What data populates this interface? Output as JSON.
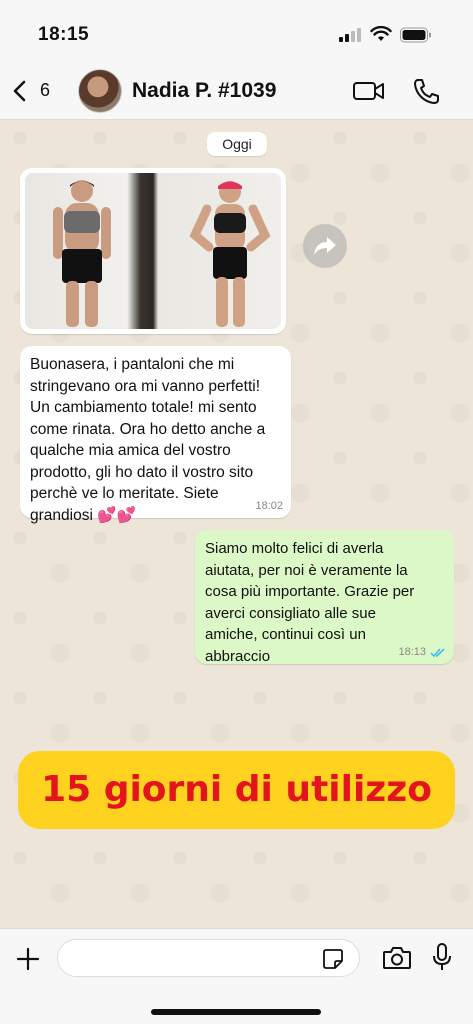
{
  "status_bar": {
    "time": "18:15",
    "icons": [
      "signal-icon",
      "wifi-icon",
      "battery-icon"
    ]
  },
  "header": {
    "unread_count": "6",
    "contact_name": "Nadia P. #1039",
    "icons": [
      "chevron-left-icon",
      "video-icon",
      "phone-icon"
    ]
  },
  "chat": {
    "date_label": "Oggi",
    "incoming_message": {
      "text": "Buonasera, i pantaloni che mi\nstringevano ora mi vanno perfetti!\nUn cambiamento totale! mi sento\ncome rinata. Ora ho detto anche a\nqualche mia amica del vostro\nprodotto, gli ho dato il vostro sito\nperchè ve lo meritate. Siete\ngrandiosi 💕💕",
      "time": "18:02"
    },
    "outgoing_message": {
      "text": "Siamo molto felici di averla\naiutata, per noi è veramente la\ncosa più importante. Grazie per\naverci consigliato alle sue\namiche, continui così un\nabbraccio",
      "time": "18:13",
      "status": "read"
    }
  },
  "banner": {
    "text": "15 giorni di utilizzo",
    "background": "#ffd21f",
    "text_color": "#e3151c"
  },
  "input_bar": {
    "icons": [
      "plus-icon",
      "sticker-icon",
      "camera-icon",
      "microphone-icon"
    ]
  },
  "colors": {
    "outgoing_bubble": "#dcf8c6",
    "incoming_bubble": "#ffffff",
    "read_ticks": "#34b7f1"
  }
}
